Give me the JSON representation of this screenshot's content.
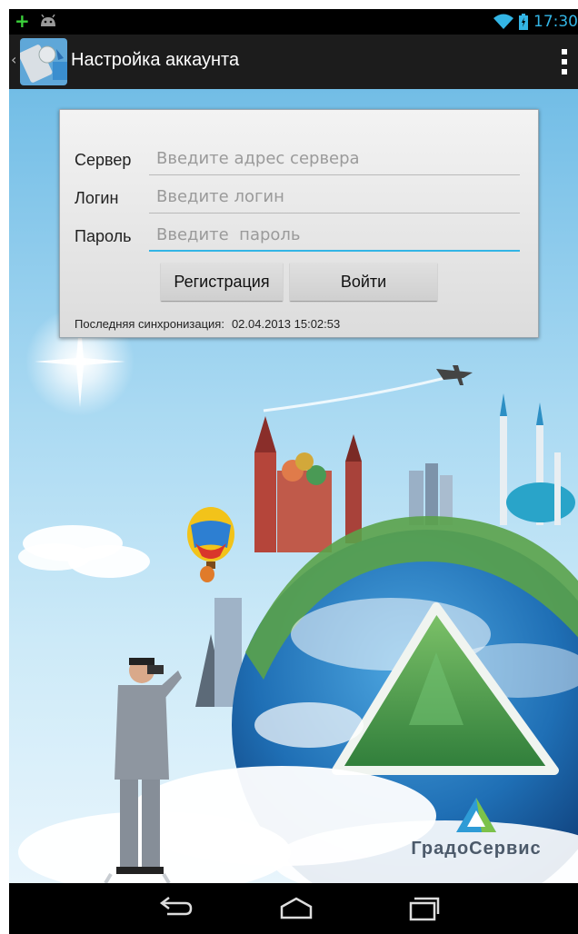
{
  "status_bar": {
    "time": "17:30"
  },
  "action_bar": {
    "title": "Настройка аккаунта"
  },
  "form": {
    "server": {
      "label": "Сервер",
      "placeholder": "Введите адрес сервера",
      "value": ""
    },
    "login": {
      "label": "Логин",
      "placeholder": "Введите логин",
      "value": ""
    },
    "password": {
      "label": "Пароль",
      "placeholder": "Введите  пароль",
      "value": ""
    },
    "register_label": "Регистрация",
    "signin_label": "Войти",
    "sync_label": "Последняя синхронизация:",
    "sync_value": "02.04.2013 15:02:53"
  },
  "brand": {
    "name": "ГрадоСервис"
  },
  "icons": {
    "notification_plus": "plus-icon",
    "notification_android": "android-icon",
    "wifi": "wifi-icon",
    "battery": "battery-icon",
    "app": "app-logo-icon",
    "overflow": "overflow-menu-icon",
    "back": "back-icon",
    "home": "home-icon",
    "recents": "recents-icon"
  },
  "colors": {
    "accent": "#33b5e5",
    "action_bar": "#1c1c1c"
  }
}
